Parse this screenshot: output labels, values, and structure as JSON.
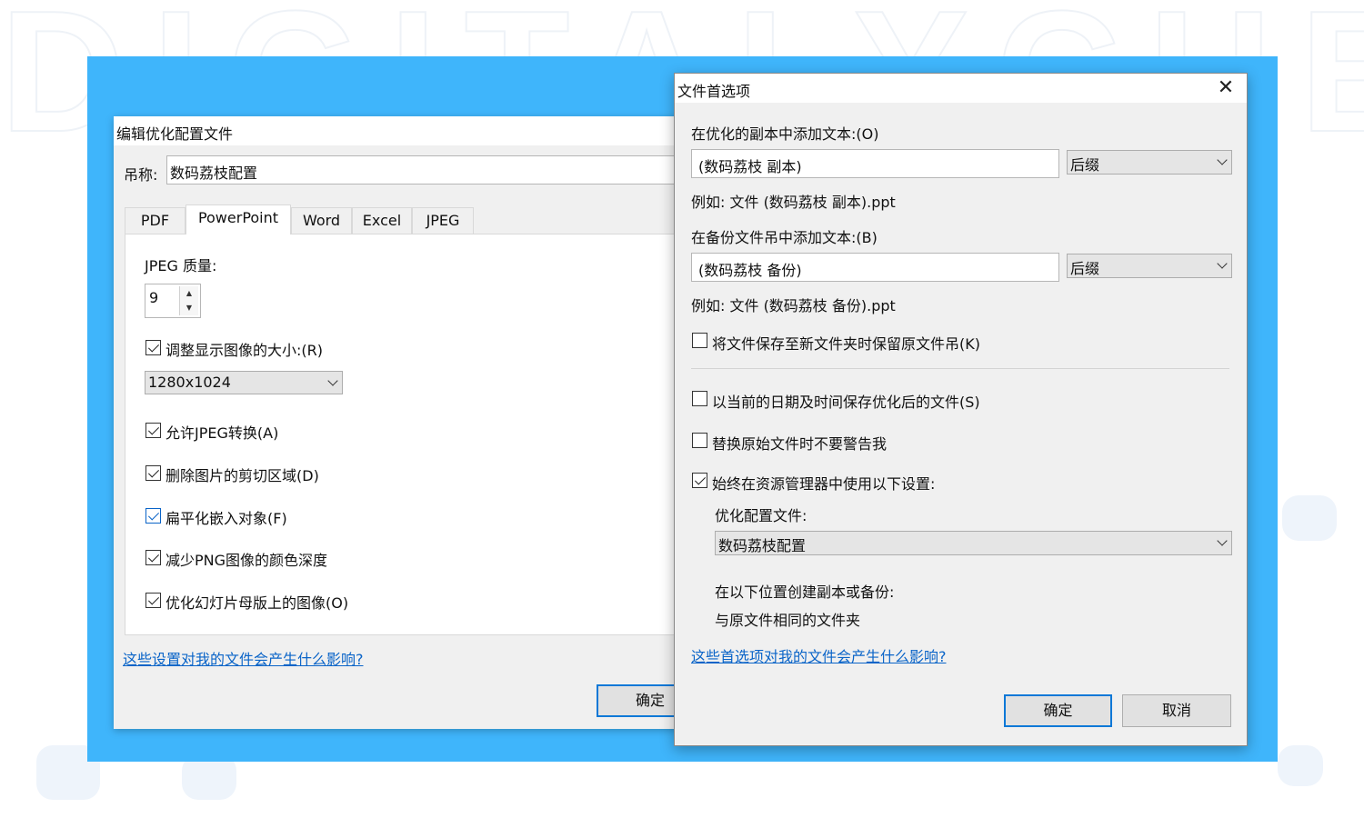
{
  "left_dialog": {
    "title": "编辑优化配置文件",
    "name_label": "吊称:",
    "name_value": "数码荔枝配置",
    "tabs": [
      {
        "label": "PDF",
        "active": false
      },
      {
        "label": "PowerPoint",
        "active": true
      },
      {
        "label": "Word",
        "active": false
      },
      {
        "label": "Excel",
        "active": false
      },
      {
        "label": "JPEG",
        "active": false
      }
    ],
    "jpeg_quality_label": "JPEG 质量:",
    "jpeg_quality_value": "9",
    "resize_checkbox": {
      "label": "调整显示图像的大小:(R)",
      "checked": true
    },
    "resize_select": "1280x1024",
    "checkboxes": [
      {
        "label": "允许JPEG转换(A)",
        "checked": true
      },
      {
        "label": "删除图片的剪切区域(D)",
        "checked": true
      },
      {
        "label": "扁平化嵌入对象(F)",
        "checked": true
      },
      {
        "label": "减少PNG图像的颜色深度",
        "checked": true
      },
      {
        "label": "优化幻灯片母版上的图像(O)",
        "checked": true
      }
    ],
    "help_link": "这些设置对我的文件会产生什么影响?",
    "ok_button": "确定"
  },
  "right_dialog": {
    "title": "文件首选项",
    "close_icon": "close-icon",
    "copy_label": "在优化的副本中添加文本:(O)",
    "copy_value": "(数码荔枝 副本)",
    "copy_position": "后缀",
    "copy_example": "例如:  文件 (数码荔枝 副本).ppt",
    "backup_label": "在备份文件吊中添加文本:(B)",
    "backup_value": "(数码荔枝 备份)",
    "backup_position": "后缀",
    "backup_example": "例如:  文件 (数码荔枝 备份).ppt",
    "keep_name_checkbox": {
      "label": "将文件保存至新文件夹时保留原文件吊(K)",
      "checked": false
    },
    "save_date_checkbox": {
      "label": "以当前的日期及时间保存优化后的文件(S)",
      "checked": false
    },
    "no_warn_checkbox": {
      "label": "替换原始文件时不要警告我",
      "checked": false
    },
    "always_use_checkbox": {
      "label": "始终在资源管理器中使用以下设置:",
      "checked": true
    },
    "profile_label": "优化配置文件:",
    "profile_value": "数码荔枝配置",
    "location_label": "在以下位置创建副本或备份:",
    "location_value": "与原文件相同的文件夹",
    "help_link": "这些首选项对我的文件会产生什么影响?",
    "ok_button": "确定",
    "cancel_button": "取消"
  },
  "colors": {
    "panel_bg": "#3fb5fb",
    "link": "#0a64c8",
    "default_button_border": "#0a78d7"
  }
}
